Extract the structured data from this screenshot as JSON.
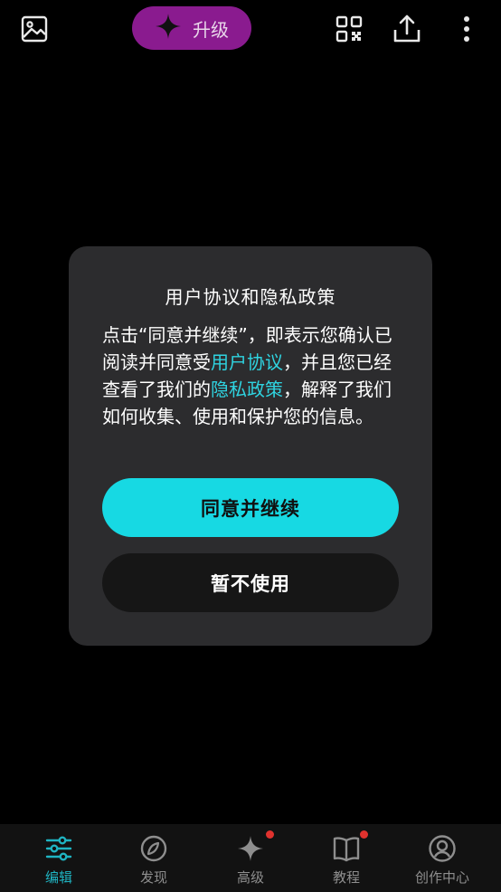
{
  "toolbar": {
    "upgrade_label": "升级",
    "icons": [
      "image-icon",
      "qr-code-icon",
      "share-icon",
      "more-vertical-icon"
    ]
  },
  "dialog": {
    "title": "用户协议和隐私政策",
    "body_part1": "点击“同意并继续”，即表示您确认已阅读并同意受",
    "link_user_agreement": "用户协议",
    "body_part2": "，并且您已经查看了我们的",
    "link_privacy_policy": "隐私政策",
    "body_part3": "，解释了我们如何收集、使用和保护您的信息。",
    "agree_label": "同意并继续",
    "decline_label": "暂不使用"
  },
  "bottom_nav": {
    "items": [
      {
        "label": "编辑",
        "icon": "sliders-icon",
        "active": true
      },
      {
        "label": "发现",
        "icon": "compass-icon",
        "active": false
      },
      {
        "label": "高级",
        "icon": "sparkle-icon",
        "active": false,
        "badge": true
      },
      {
        "label": "教程",
        "icon": "book-icon",
        "active": false,
        "badge": true
      },
      {
        "label": "创作中心",
        "icon": "user-circle-icon",
        "active": false
      }
    ]
  },
  "colors": {
    "accent": "#17d9e3",
    "upgrade_bg": "#8a1b8f",
    "dialog_bg": "#2c2c2e",
    "badge": "#e0322e"
  }
}
